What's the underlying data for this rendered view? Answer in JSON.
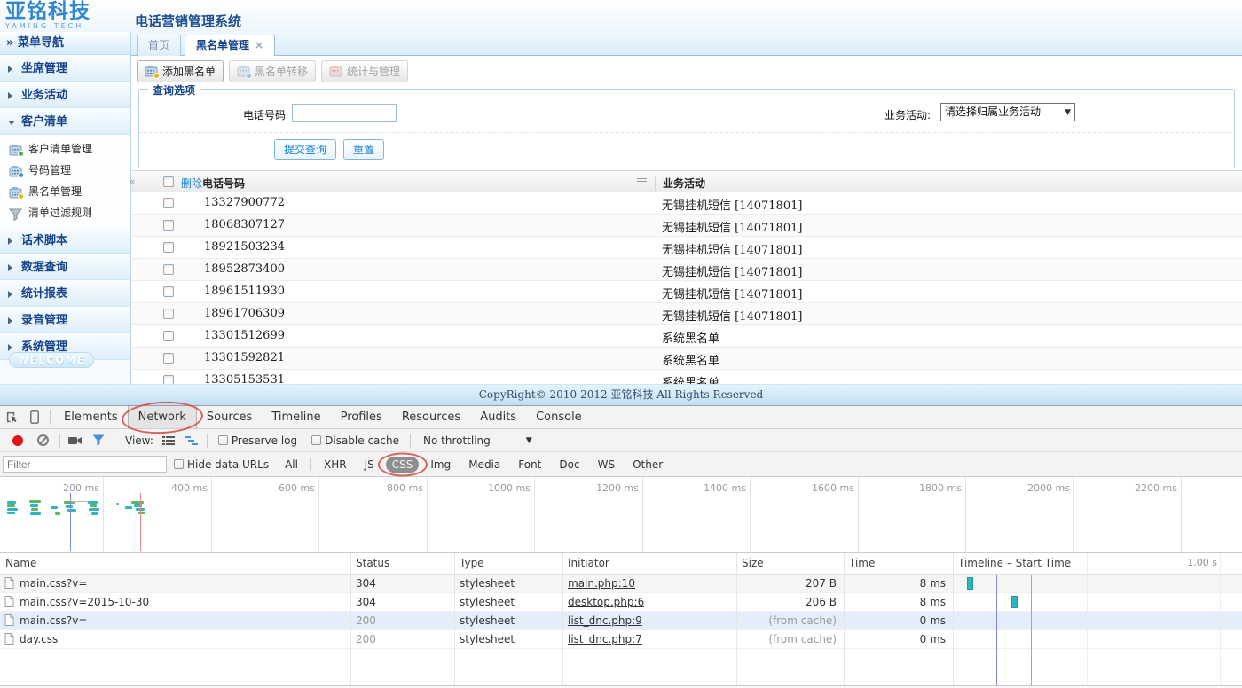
{
  "header": {
    "logo_cn": "亚铭科技",
    "logo_en": "YAMING TECH",
    "app_title": "电话营销管理系统"
  },
  "glyphs": {
    "nav_arrows": "»",
    "collapse_left": "«",
    "close": "×",
    "caret_down": "▼"
  },
  "sidebar": {
    "nav_title": "菜单导航",
    "sections": [
      {
        "label": "坐席管理"
      },
      {
        "label": "业务活动"
      },
      {
        "label": "客户清单"
      },
      {
        "label": "话术脚本"
      },
      {
        "label": "数据查询"
      },
      {
        "label": "统计报表"
      },
      {
        "label": "录音管理"
      },
      {
        "label": "系统管理"
      }
    ],
    "customer_list_items": [
      {
        "label": "客户清单管理",
        "icon": "phone-add-icon"
      },
      {
        "label": "号码管理",
        "icon": "phone-transfer-icon"
      },
      {
        "label": "黑名单管理",
        "icon": "phone-lock-icon"
      },
      {
        "label": "清单过滤规则",
        "icon": "filter-icon"
      }
    ],
    "welcome_badge": "WELCOME"
  },
  "tabs": {
    "home": "首页",
    "active": "黑名单管理"
  },
  "toolbar": {
    "add": "添加黑名单",
    "transfer": "黑名单转移",
    "stats": "统计与管理"
  },
  "query": {
    "legend": "查询选项",
    "phone_label": "电话号码",
    "phone_value": "",
    "activity_label": "业务活动:",
    "activity_selected": "请选择归属业务活动",
    "submit": "提交查询",
    "reset": "重置"
  },
  "grid": {
    "delete_label": "删除",
    "phone_col": "电话号码",
    "activity_col": "业务活动",
    "rows": [
      {
        "phone": "13327900772",
        "activity": "无锡挂机短信 [14071801]"
      },
      {
        "phone": "18068307127",
        "activity": "无锡挂机短信 [14071801]"
      },
      {
        "phone": "18921503234",
        "activity": "无锡挂机短信 [14071801]"
      },
      {
        "phone": "18952873400",
        "activity": "无锡挂机短信 [14071801]"
      },
      {
        "phone": "18961511930",
        "activity": "无锡挂机短信 [14071801]"
      },
      {
        "phone": "18961706309",
        "activity": "无锡挂机短信 [14071801]"
      },
      {
        "phone": "13301512699",
        "activity": "系统黑名单"
      },
      {
        "phone": "13301592821",
        "activity": "系统黑名单"
      },
      {
        "phone": "13305153531",
        "activity": "系统黑名单"
      }
    ]
  },
  "footer": {
    "copyright": "CopyRight© 2010-2012 亚铭科技 All Rights Reserved"
  },
  "devtools": {
    "tabs": [
      "Elements",
      "Network",
      "Sources",
      "Timeline",
      "Profiles",
      "Resources",
      "Audits",
      "Console"
    ],
    "active_tab": "Network",
    "toolbar": {
      "view_label": "View:",
      "preserve_log": "Preserve log",
      "disable_cache": "Disable cache",
      "throttling": "No throttling"
    },
    "filter": {
      "placeholder": "Filter",
      "hide_data_urls": "Hide data URLs",
      "types": [
        "All",
        "XHR",
        "JS",
        "CSS",
        "Img",
        "Media",
        "Font",
        "Doc",
        "WS",
        "Other"
      ],
      "selected_type": "CSS"
    },
    "overview_ticks": [
      "200 ms",
      "400 ms",
      "600 ms",
      "800 ms",
      "1000 ms",
      "1200 ms",
      "1400 ms",
      "1600 ms",
      "1800 ms",
      "2000 ms",
      "2200 ms"
    ],
    "network_table": {
      "columns": [
        "Name",
        "Status",
        "Type",
        "Initiator",
        "Size",
        "Time",
        "Timeline – Start Time"
      ],
      "scale_label": "1.00 s",
      "rows": [
        {
          "name": "main.css?v=",
          "status": "304",
          "type": "stylesheet",
          "initiator": "main.php:10",
          "size": "207 B",
          "time": "8 ms"
        },
        {
          "name": "main.css?v=2015-10-30",
          "status": "304",
          "type": "stylesheet",
          "initiator": "desktop.php:6",
          "size": "206 B",
          "time": "8 ms"
        },
        {
          "name": "main.css?v=",
          "status": "200",
          "type": "stylesheet",
          "initiator": "list_dnc.php:9",
          "size": "(from cache)",
          "time": "0 ms"
        },
        {
          "name": "day.css",
          "status": "200",
          "type": "stylesheet",
          "initiator": "list_dnc.php:7",
          "size": "(from cache)",
          "time": "0 ms"
        }
      ]
    }
  },
  "colors": {
    "accent_navy": "#15428b",
    "link_blue": "#1580cf",
    "devtools_teal": "#2fb5c0",
    "record_red": "#e01414",
    "annotation_red": "#d34941"
  }
}
